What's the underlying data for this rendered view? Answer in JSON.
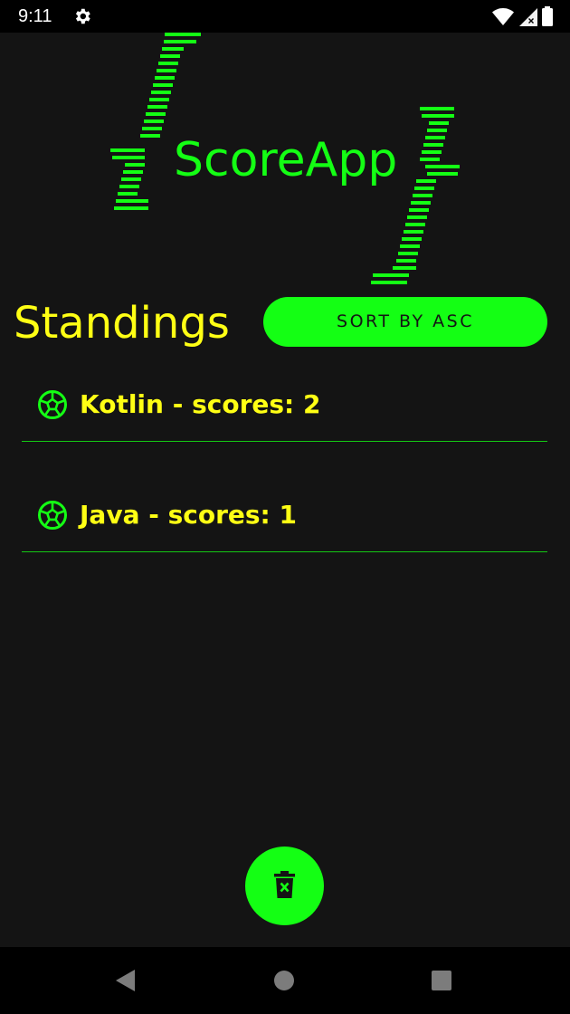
{
  "status_bar": {
    "time": "9:11",
    "icons": [
      "gear-icon",
      "wifi-icon",
      "signal-icon",
      "battery-icon"
    ]
  },
  "logo": {
    "text": "ScoreApp"
  },
  "header": {
    "title": "Standings",
    "sort_button_label": "SORT BY ASC"
  },
  "standings": [
    {
      "label": "Kotlin - scores: 2",
      "icon": "soccer-ball-icon"
    },
    {
      "label": "Java - scores: 1",
      "icon": "soccer-ball-icon"
    }
  ],
  "fab": {
    "icon": "delete-icon"
  },
  "nav_bar": {
    "buttons": [
      "back-icon",
      "home-icon",
      "recents-icon"
    ]
  },
  "colors": {
    "accent_green": "#14ff14",
    "text_yellow": "#ffff14",
    "background": "#141414",
    "bar_black": "#000000"
  }
}
